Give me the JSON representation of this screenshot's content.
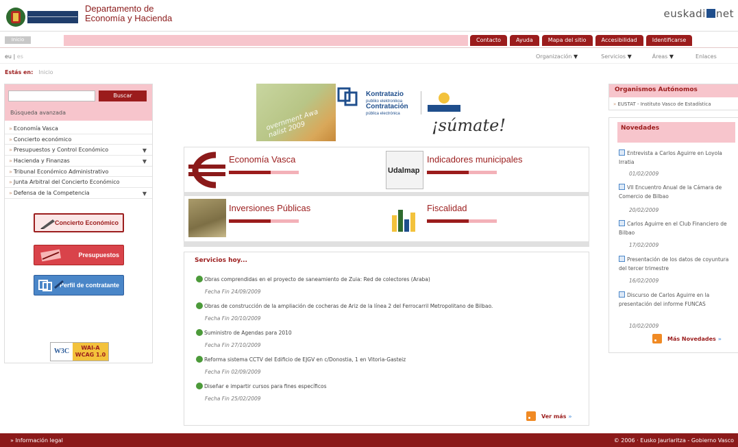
{
  "header": {
    "dept_line1": "Departamento de",
    "dept_line2": "Economía y Hacienda",
    "portal_pre": "euskadi",
    "portal_post": "net",
    "logo_text": "EUSKO JAURLARITZA GOBIERNO VASCO"
  },
  "topnav": {
    "inicio": "Inicio",
    "items": [
      "Contacto",
      "Ayuda",
      "Mapa del sitio",
      "Accesibilidad",
      "Identificarse"
    ]
  },
  "lang": {
    "eu": "eu",
    "es": "es"
  },
  "subnav": [
    "Organización",
    "Servicios",
    "Áreas",
    "Enlaces"
  ],
  "breadcrumb": {
    "label": "Estás en:",
    "value": "Inicio"
  },
  "search": {
    "button": "Buscar",
    "advanced": "Búsqueda avanzada"
  },
  "leftmenu": [
    {
      "label": "Economía Vasca",
      "dd": false
    },
    {
      "label": "Concierto económico",
      "dd": false
    },
    {
      "label": "Presupuestos y Control Económico",
      "dd": true
    },
    {
      "label": "Hacienda y Finanzas",
      "dd": true
    },
    {
      "label": "Tribunal Económico Administrativo",
      "dd": false
    },
    {
      "label": "Junta Arbitral del Concierto Económico",
      "dd": false
    },
    {
      "label": "Defensa de la Competencia",
      "dd": true
    }
  ],
  "leftbuttons": {
    "concierto": "Concierto Económico",
    "presupuestos": "Presupuestos",
    "perfil": "Perfil de contratante"
  },
  "wai": {
    "w3c": "W3C",
    "level": "WAI-A",
    "wcag": "WCAG 1.0"
  },
  "banner": {
    "gov": "overnment Awa nalist 2009",
    "kontratazio": "Kontratazio",
    "kontratazio_sub": "publiko elektronikoa",
    "contratacion": "Contratación",
    "contratacion_sub": "pública electrónica",
    "sumate": "¡súmate!"
  },
  "grid": {
    "economia": "Economía Vasca",
    "indicadores": "Indicadores municipales",
    "udalmap": "Udalmap",
    "inversiones": "Inversiones Públicas",
    "fiscalidad": "Fiscalidad"
  },
  "servicios": {
    "title": "Servicios hoy...",
    "items": [
      {
        "text": "Obras comprendidas en el proyecto de saneamiento de Zuia: Red de colectores (Araba)",
        "date": "Fecha Fin 24/09/2009"
      },
      {
        "text": "Obras de construcción de la ampliación de cocheras de Ariz de la línea 2 del Ferrocarril Metropolitano de Bilbao.",
        "date": "Fecha Fin 20/10/2009"
      },
      {
        "text": "Suministro de Agendas para 2010",
        "date": "Fecha Fin 27/10/2009"
      },
      {
        "text": "Reforma sistema CCTV del Edificio de EJGV en c/Donostia, 1 en Vitoria-Gasteiz",
        "date": "Fecha Fin 02/09/2009"
      },
      {
        "text": "Diseñar e impartir cursos para fines específicos",
        "date": "Fecha Fin 25/02/2009"
      }
    ],
    "vermas": "Ver más"
  },
  "organismos": {
    "title": "Organismos Autónomos",
    "item": "EUSTAT - Instituto Vasco de Estadística"
  },
  "novedades": {
    "title": "Novedades",
    "items": [
      {
        "text": "Entrevista a Carlos Aguirre en Loyola Irratia",
        "date": "01/02/2009"
      },
      {
        "text": "VII Encuentro Anual de la Cámara de Comercio de Bilbao",
        "date": "20/02/2009"
      },
      {
        "text": "Carlos Aguirre en el Club Financiero de Bilbao",
        "date": "17/02/2009"
      },
      {
        "text": "Presentación de los datos de coyuntura del tercer trimestre",
        "date": "16/02/2009"
      },
      {
        "text": "Discurso de Carlos Aguirre en la presentación del informe FUNCAS",
        "date": "10/02/2009"
      }
    ],
    "mas": "Más Novedades"
  },
  "footer": {
    "left": "Información legal",
    "right": "© 2006 · Eusko Jaurlaritza - Gobierno Vasco"
  },
  "colors": {
    "brand": "#9b1c1c",
    "pink": "#f7c5cc",
    "blue": "#1f4e8c"
  }
}
